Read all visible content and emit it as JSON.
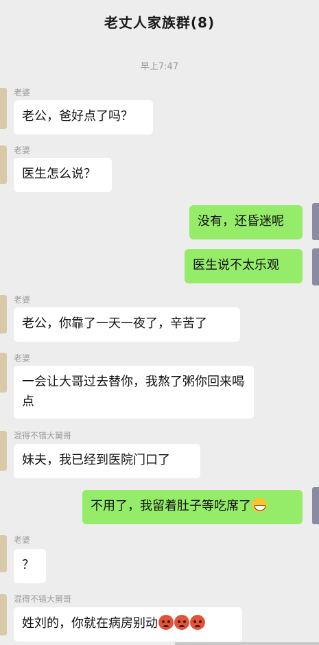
{
  "header": {
    "title": "老丈人家族群(8)"
  },
  "timestamp": "早上7:47",
  "messages": [
    {
      "sender": "老婆",
      "text": "老公，爸好点了吗？",
      "mine": false
    },
    {
      "sender": "老婆",
      "text": "医生怎么说？",
      "mine": false
    },
    {
      "sender": "",
      "text": "没有，还昏迷呢",
      "mine": true
    },
    {
      "sender": "",
      "text": "医生说不太乐观",
      "mine": true
    },
    {
      "sender": "老婆",
      "text": "老公，你靠了一天一夜了，辛苦了",
      "mine": false
    },
    {
      "sender": "老婆",
      "text": "一会让大哥过去替你，我熬了粥你回来喝点",
      "mine": false
    },
    {
      "sender": "混得不错大舅哥",
      "text": "妹夫，我已经到医院门口了",
      "mine": false
    },
    {
      "sender": "",
      "text": "不用了，我留着肚子等吃席了",
      "mine": true,
      "emoji": "grinning-face"
    },
    {
      "sender": "老婆",
      "text": "？",
      "mine": false
    },
    {
      "sender": "混得不错大舅哥",
      "text": "姓刘的，你就在病房别动",
      "mine": false,
      "emoji": "angry-face x3"
    }
  ],
  "colors": {
    "background": "#ededed",
    "my_bubble": "#95ec69",
    "their_bubble": "#ffffff"
  }
}
